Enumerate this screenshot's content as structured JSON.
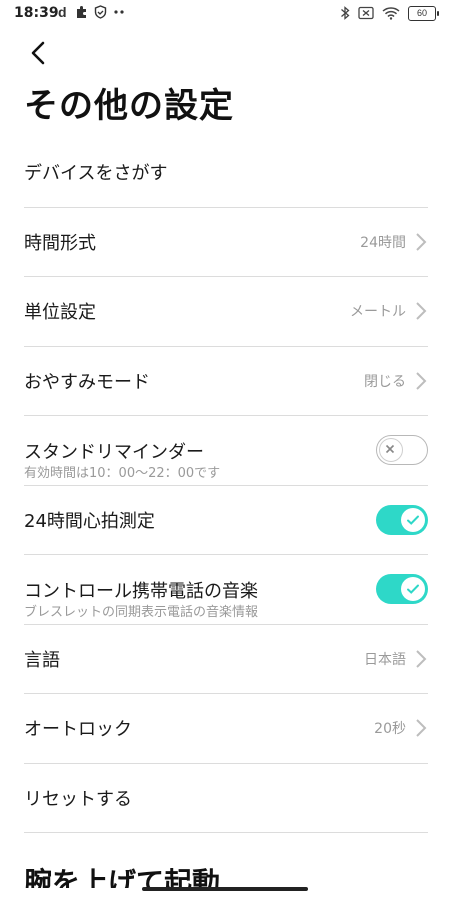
{
  "status": {
    "time": "18:39",
    "battery": "60"
  },
  "header": {
    "title": "その他の設定"
  },
  "settings": [
    {
      "label": "デバイスをさがす"
    },
    {
      "label": "時間形式",
      "value": "24時間"
    },
    {
      "label": "単位設定",
      "value": "メートル"
    },
    {
      "label": "おやすみモード",
      "value": "閉じる"
    },
    {
      "label": "スタンドリマインダー",
      "sub": "有効時間は10：00〜22：00です",
      "toggle": false
    },
    {
      "label": "24時間心拍測定",
      "toggle": true
    },
    {
      "label": "コントロール携帯電話の音楽",
      "sub": "ブレスレットの同期表示電話の音楽情報",
      "toggle": true
    },
    {
      "label": "言語",
      "value": "日本語"
    },
    {
      "label": "オートロック",
      "value": "20秒"
    },
    {
      "label": "リセットする"
    }
  ],
  "next_section": {
    "title": "腕を上げて起動"
  },
  "colors": {
    "accent": "#2ed8c8",
    "divider": "#dcdcdc",
    "secondary_text": "#9a9a9a"
  }
}
